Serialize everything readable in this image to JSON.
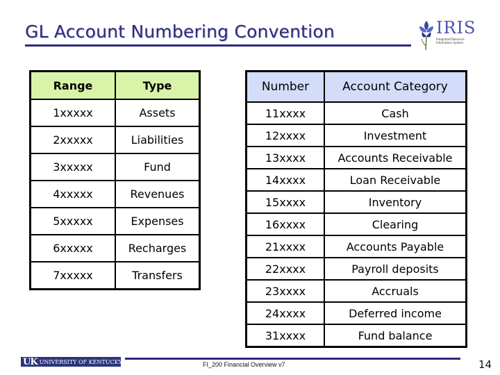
{
  "slide": {
    "title": "GL Account Numbering Convention",
    "logo": {
      "name": "IRIS",
      "subtitle": "Integrated Resource Information System"
    }
  },
  "left_table": {
    "headers": [
      "Range",
      "Type"
    ],
    "header_color": "#d9f4a8",
    "rows": [
      [
        "1xxxxx",
        "Assets"
      ],
      [
        "2xxxxx",
        "Liabilities"
      ],
      [
        "3xxxxx",
        "Fund"
      ],
      [
        "4xxxxx",
        "Revenues"
      ],
      [
        "5xxxxx",
        "Expenses"
      ],
      [
        "6xxxxx",
        "Recharges"
      ],
      [
        "7xxxxx",
        "Transfers"
      ]
    ]
  },
  "right_table": {
    "headers": [
      "Number",
      "Account Category"
    ],
    "header_color": "#d3dcf8",
    "rows": [
      [
        "11xxxx",
        "Cash"
      ],
      [
        "12xxxx",
        "Investment"
      ],
      [
        "13xxxx",
        "Accounts Receivable"
      ],
      [
        "14xxxx",
        "Loan Receivable"
      ],
      [
        "15xxxx",
        "Inventory"
      ],
      [
        "16xxxx",
        "Clearing"
      ],
      [
        "21xxxx",
        "Accounts Payable"
      ],
      [
        "22xxxx",
        "Payroll deposits"
      ],
      [
        "23xxxx",
        "Accruals"
      ],
      [
        "24xxxx",
        "Deferred income"
      ],
      [
        "31xxxx",
        "Fund balance"
      ]
    ]
  },
  "footer": {
    "org_logo_mark": "UK",
    "org_logo_text": "UNIVERSITY OF KENTUCKY",
    "caption": "FI_200 Financial Overview v7",
    "page_number": "14"
  },
  "colors": {
    "title": "#2a2a7c",
    "rule": "#2a2a7c"
  }
}
